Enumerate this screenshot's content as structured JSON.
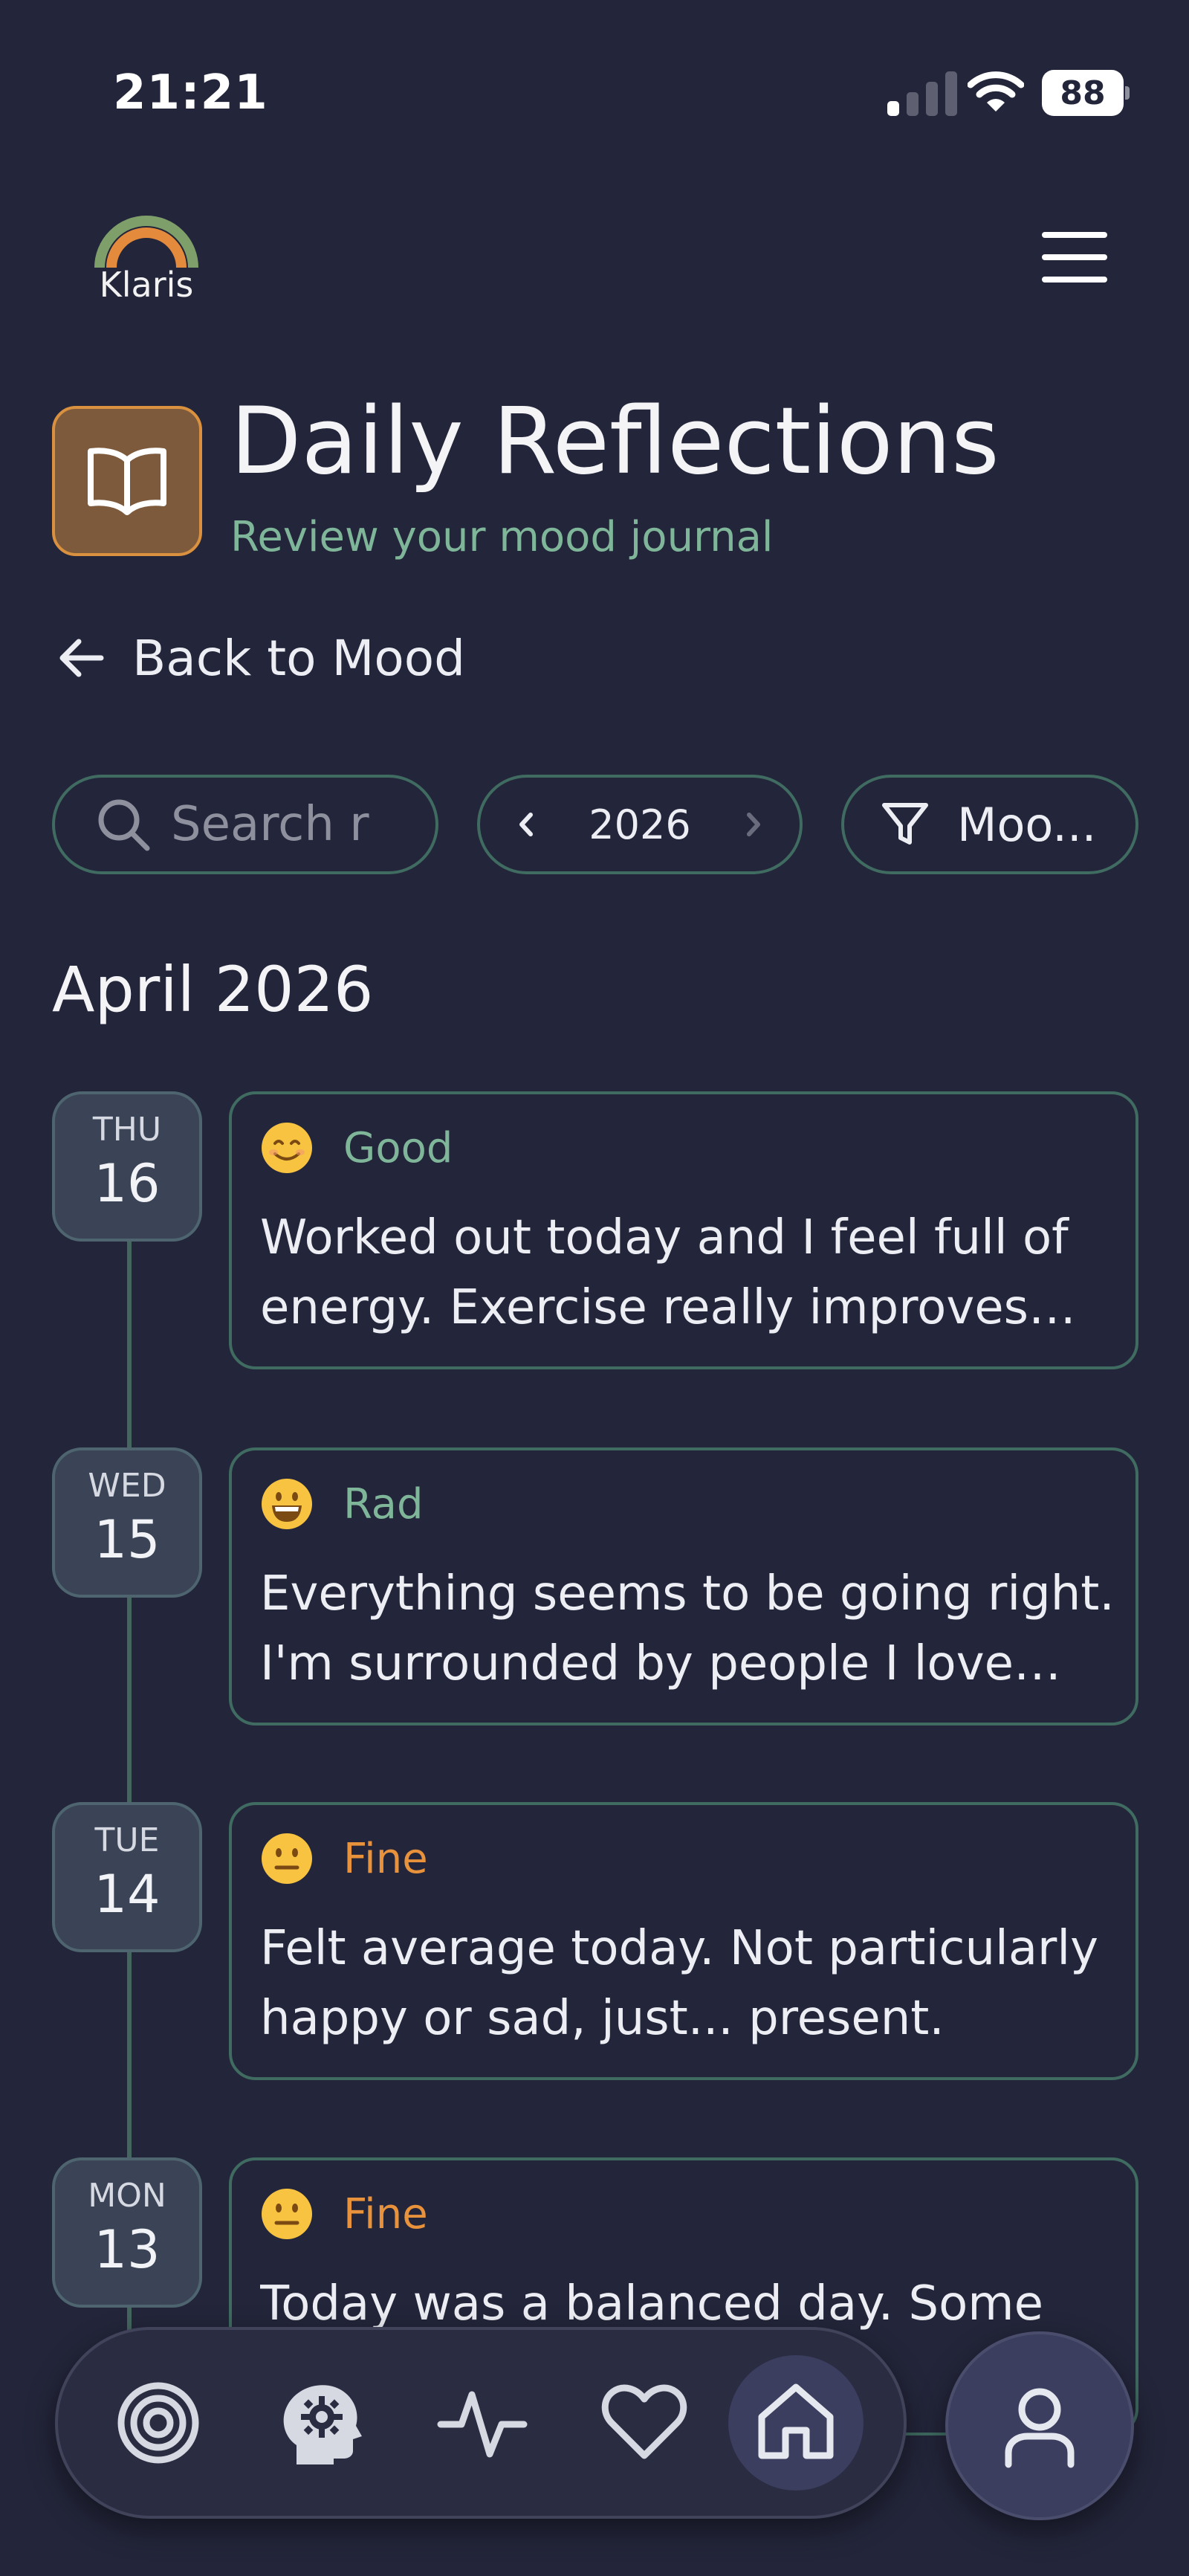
{
  "status_bar": {
    "time": "21:21",
    "battery_level": "88",
    "signal_bars_active": 1,
    "signal_bars_total": 4,
    "icons": [
      "signal-icon",
      "wifi-icon",
      "battery-icon"
    ]
  },
  "header": {
    "logo_text": "Klaris",
    "menu_icon": "hamburger-menu-icon"
  },
  "page": {
    "icon": "open-book-icon",
    "title": "Daily Reflections",
    "subtitle": "Review your mood journal",
    "back_label": "Back to Mood"
  },
  "filters": {
    "search_placeholder": "Search r",
    "year": "2026",
    "mood_filter_label": "Moo..."
  },
  "month_heading": "April 2026",
  "entries": [
    {
      "dow": "THU",
      "day": "16",
      "mood": "Good",
      "mood_emoji": "smiling-face-icon",
      "mood_color": "#7fb69a",
      "text": "Worked out today and I feel full of energy. Exercise really improves my ..."
    },
    {
      "dow": "WED",
      "day": "15",
      "mood": "Rad",
      "mood_emoji": "grinning-face-icon",
      "mood_color": "#7fb69a",
      "text": "Everything seems to be going right. I'm surrounded by people I love who ..."
    },
    {
      "dow": "TUE",
      "day": "14",
      "mood": "Fine",
      "mood_emoji": "neutral-face-icon",
      "mood_color": "#e8923c",
      "text": "Felt average today. Not particularly happy or sad, just... present."
    },
    {
      "dow": "MON",
      "day": "13",
      "mood": "Fine",
      "mood_emoji": "neutral-face-icon",
      "mood_color": "#e8923c",
      "text": "Today was a balanced day. Some thir"
    }
  ],
  "bottom_nav": {
    "items": [
      "target-icon",
      "mind-gear-icon",
      "pulse-icon",
      "heart-icon",
      "home-icon"
    ],
    "active": "home-icon",
    "profile_icon": "user-icon"
  },
  "colors": {
    "background": "#23253a",
    "accent_green": "#7fb69a",
    "accent_orange": "#e8923c",
    "border_green": "#3f6b61",
    "title_icon_bg": "#7d5a3b"
  }
}
